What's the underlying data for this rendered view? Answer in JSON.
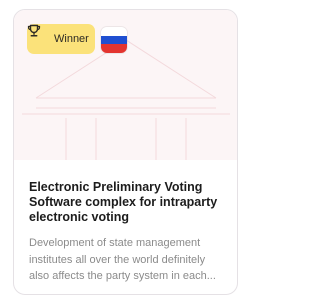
{
  "card": {
    "badge_label": "Winner",
    "badge_icon": "trophy-icon",
    "flag": {
      "name": "russia-flag-icon",
      "colors": [
        "#ffffff",
        "#1f4fd1",
        "#e3342f"
      ]
    },
    "title": "Electronic Preliminary Voting Software complex for intraparty electronic voting",
    "description": "Development of state management institutes all over the world definitely also affects the party system in each..."
  },
  "colors": {
    "badge_bg": "#fbe27a",
    "image_bg": "#fcf5f6",
    "title": "#1c1c1c",
    "description": "#8b8b8b"
  }
}
